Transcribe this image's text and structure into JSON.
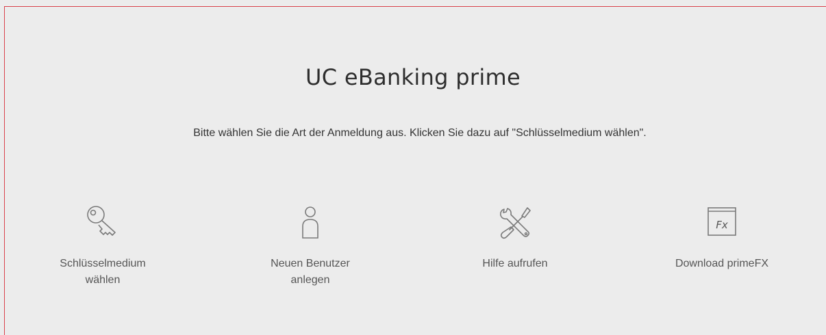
{
  "header": {
    "title": "UC eBanking prime",
    "instruction": "Bitte wählen Sie die Art der Anmeldung aus. Klicken Sie dazu auf \"Schlüsselmedium wählen\"."
  },
  "actions": [
    {
      "label": "Schlüsselmedium wählen",
      "icon": "key-icon"
    },
    {
      "label": "Neuen Benutzer anlegen",
      "icon": "user-icon"
    },
    {
      "label": "Hilfe aufrufen",
      "icon": "tools-icon"
    },
    {
      "label": "Download primeFX",
      "icon": "primefx-icon",
      "icon_text": "Fx"
    }
  ],
  "colors": {
    "background": "#ececec",
    "accent_border": "#d9404a",
    "icon_stroke": "#7a7a7a",
    "text": "#333333"
  }
}
